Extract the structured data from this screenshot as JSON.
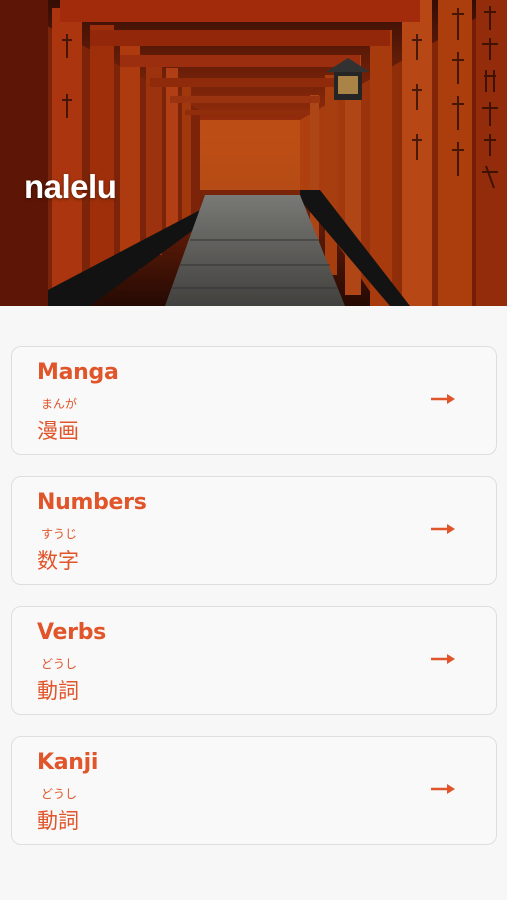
{
  "app": {
    "title": "nalelu"
  },
  "hero": {
    "image": "fushimi-inari-torii-gates"
  },
  "colors": {
    "accent": "#e0552a",
    "background": "#f7f7f7",
    "card_border": "#dedede"
  },
  "categories": [
    {
      "title": "Manga",
      "reading": "まんが",
      "word": "漫画",
      "icon": "arrow-right-icon"
    },
    {
      "title": "Numbers",
      "reading": "すうじ",
      "word": "数字",
      "icon": "arrow-right-icon"
    },
    {
      "title": "Verbs",
      "reading": "どうし",
      "word": "動詞",
      "icon": "arrow-right-icon"
    },
    {
      "title": "Kanji",
      "reading": "どうし",
      "word": "動詞",
      "icon": "arrow-right-icon"
    }
  ]
}
